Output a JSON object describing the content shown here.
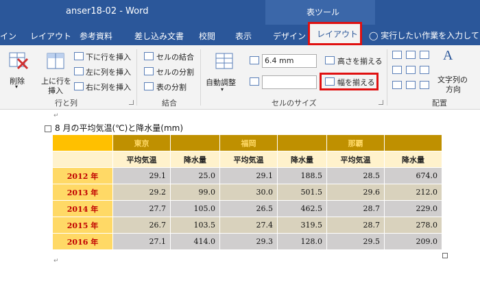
{
  "window": {
    "title": "anser18-02  -  Word",
    "context_label": "表ツール"
  },
  "tabs": [
    {
      "label": "イン"
    },
    {
      "label": "レイアウト"
    },
    {
      "label": "参考資料"
    },
    {
      "label": "差し込み文書"
    },
    {
      "label": "校閲"
    },
    {
      "label": "表示"
    },
    {
      "label": "デザイン"
    }
  ],
  "active_tab": "レイアウト",
  "tell_me": "実行したい作業を入力してくだ",
  "ribbon": {
    "delete_label": "削除",
    "insert_above_label": "上に行を挿入",
    "insert_above_line1": "上に行を",
    "insert_above_line2": "挿入",
    "insert_below": "下に行を挿入",
    "insert_left": "左に列を挿入",
    "insert_right": "右に列を挿入",
    "rows_cols_group": "行と列",
    "merge_cells": "セルの結合",
    "split_cells": "セルの分割",
    "split_table": "表の分割",
    "merge_group": "結合",
    "autofit": "自動調整",
    "height_value": "6.4 mm",
    "width_value": "",
    "distribute_rows": "高さを揃える",
    "distribute_cols": "幅を揃える",
    "cell_size_group": "セルのサイズ",
    "text_direction_line1": "文字列の",
    "text_direction_line2": "方向",
    "align_group": "配置"
  },
  "document": {
    "title": "8 月の平均気温(℃)と降水量(mm)",
    "para_mark": "↵",
    "cities": [
      "東京",
      "福岡",
      "那覇"
    ],
    "sub_headers": [
      "平均気温",
      "降水量",
      "平均気温",
      "降水量",
      "平均気温",
      "降水量"
    ],
    "rows": [
      {
        "year": "2012 年",
        "values": [
          "29.1",
          "25.0",
          "29.1",
          "188.5",
          "28.5",
          "674.0"
        ]
      },
      {
        "year": "2013 年",
        "values": [
          "29.2",
          "99.0",
          "30.0",
          "501.5",
          "29.6",
          "212.0"
        ]
      },
      {
        "year": "2014 年",
        "values": [
          "27.7",
          "105.0",
          "26.5",
          "462.5",
          "28.7",
          "229.0"
        ]
      },
      {
        "year": "2015 年",
        "values": [
          "26.7",
          "103.5",
          "27.4",
          "319.5",
          "28.7",
          "278.0"
        ]
      },
      {
        "year": "2016 年",
        "values": [
          "27.1",
          "414.0",
          "29.3",
          "128.0",
          "29.5",
          "209.0"
        ]
      }
    ]
  },
  "colors": {
    "word_blue": "#2b579a",
    "highlight_red": "#e01010",
    "header_gold": "#bf9000",
    "corner_orange": "#ffc000",
    "year_yellow": "#ffd966",
    "year_text_red": "#c00000",
    "subheader_cream": "#fff2cc",
    "cell_gray": "#d0cece",
    "cell_tan": "#d9d2bd"
  }
}
